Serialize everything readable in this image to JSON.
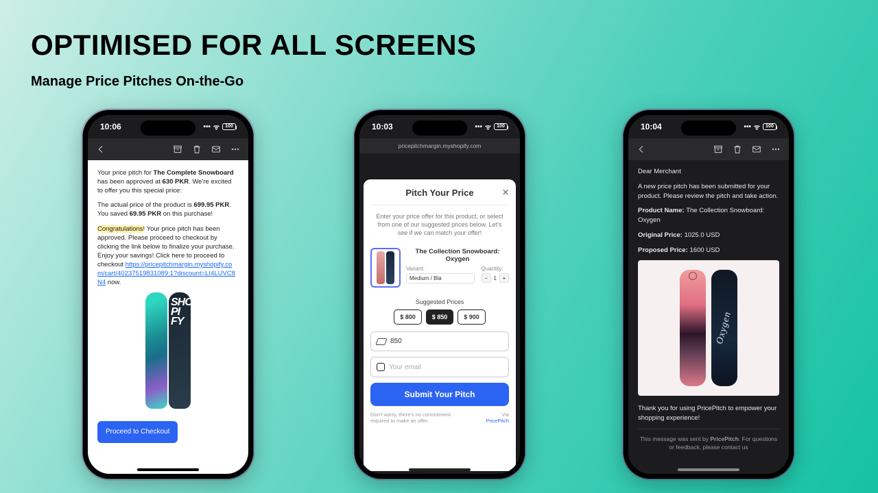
{
  "header": {
    "title": "OPTIMISED FOR ALL SCREENS",
    "subtitle": "Manage Price Pitches On-the-Go"
  },
  "status_battery": "100",
  "phone1": {
    "time": "10:06",
    "email": {
      "line1a": "Your price pitch for ",
      "product": "The Complete Snowboard",
      "line1b": " has been approved at ",
      "approved_price": "630 PKR",
      "line1c": ". We're excited to offer you this special price:",
      "line2a": "The actual price of the product is ",
      "actual_price": "699.95 PKR",
      "line2b": ". You saved ",
      "saved": "69.95 PKR",
      "line2c": " on this purchase!",
      "congrats": "Congratulations",
      "line3": "! Your price pitch has been approved. Please proceed to checkout by clicking the link below to finalize your purchase. Enjoy your savings! Click here to proceed to checkout ",
      "link": "https://pricepitchmargin.myshopify.com/cart/40237519831089:1?discount=LI4LUVC8N4",
      "now": " now.",
      "cta": "Proceed to Checkout"
    }
  },
  "phone2": {
    "time": "10:03",
    "url": "pricepitchmargin.myshopify.com",
    "modal": {
      "title": "Pitch Your Price",
      "close": "✕",
      "desc": "Enter your price offer for this product, or select from one of our suggested prices below. Let's see if we can match your offer!",
      "product_name": "The Collection Snowboard: Oxygen",
      "variant_label": "Variant:",
      "variant_value": "Medium / Bla",
      "qty_label": "Quantity:",
      "qty_value": "1",
      "suggested_label": "Suggested Prices",
      "chips": [
        "$ 800",
        "$ 850",
        "$ 900"
      ],
      "price_input": "850",
      "email_placeholder": "Your email",
      "submit": "Submit Your Pitch",
      "footer_left": "Don't worry, there's no commitment required to make an offer.",
      "footer_via": "Via",
      "footer_brand": "PricePitch"
    }
  },
  "phone3": {
    "time": "10:04",
    "email": {
      "greeting": "Dear Merchant",
      "intro": "A new price pitch has been submitted for your product. Please review the pitch and take action.",
      "pn_label": "Product Name: ",
      "pn_value": "The Collection Snowboard: Oxygen",
      "op_label": "Original Price: ",
      "op_value": "1025.0 USD",
      "pp_label": "Proposed Price: ",
      "pp_value": "1600 USD",
      "thanks": "Thank you for using PricePitch to empower your shopping experience!",
      "sent1": "This message was sent by ",
      "brand": "PricePitch",
      "sent2": ". For questions or feedback, please contact us"
    }
  }
}
